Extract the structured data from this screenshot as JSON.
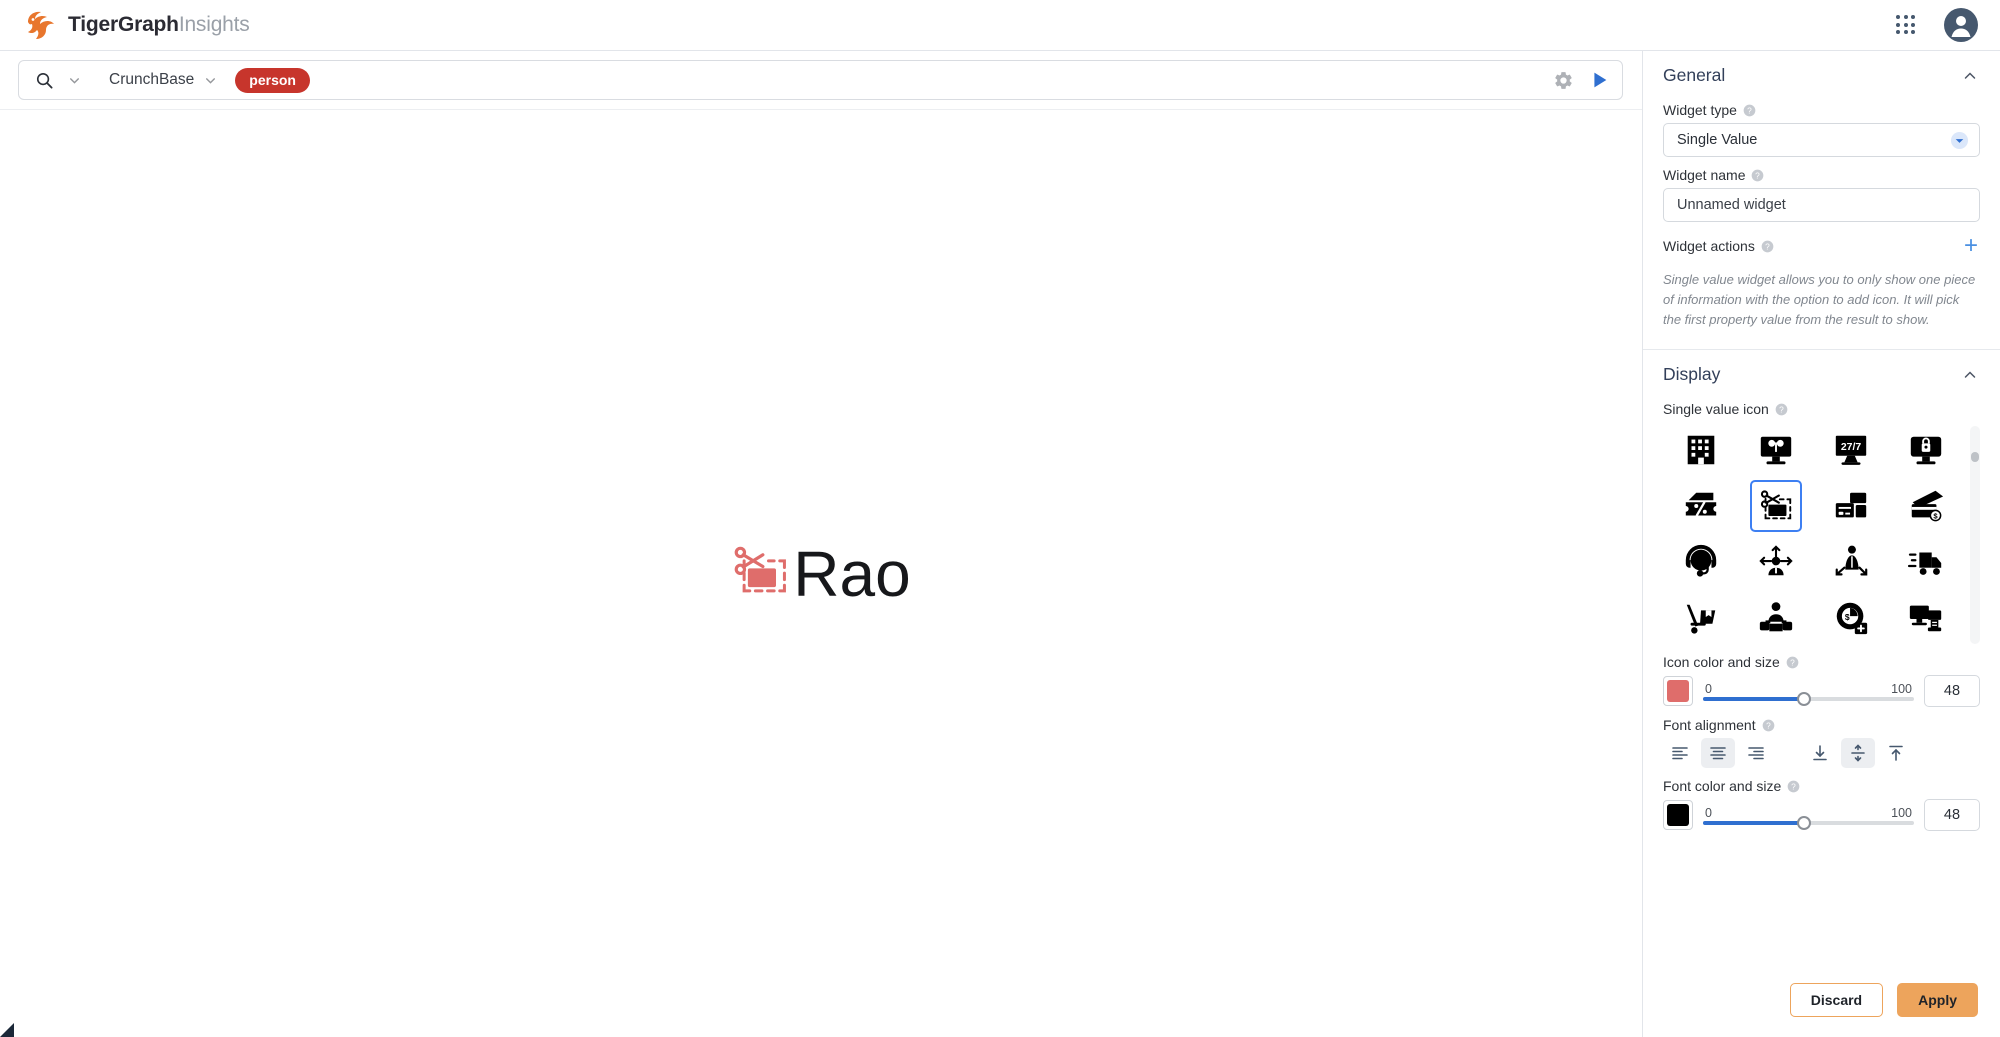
{
  "brand": {
    "name_bold": "TigerGraph",
    "name_light": "Insights",
    "logo_color": "#e8762d"
  },
  "topbar": {
    "apps_icon": "apps-grid-icon",
    "account_icon": "account-avatar-icon"
  },
  "search": {
    "search_icon": "search-icon",
    "graph_name": "CrunchBase",
    "tag": "person",
    "tag_color": "#c7352c",
    "settings_icon": "gear-icon",
    "run_icon": "play-icon"
  },
  "canvas": {
    "value_text": "Rao",
    "icon_name": "coupon-cut-icon",
    "icon_color": "#df6d6b",
    "font_color": "#17181b",
    "font_size_px": "64"
  },
  "panel": {
    "general": {
      "title": "General",
      "collapse_icon": "chevron-up-icon",
      "widget_type_label": "Widget type",
      "widget_type_value": "Single Value",
      "widget_name_label": "Widget name",
      "widget_name_value": "Unnamed widget",
      "widget_actions_label": "Widget actions",
      "add_action_label": "+",
      "hint": "Single value widget allows you to only show one piece of information with the option to add icon. It will pick the first property value from the result to show."
    },
    "display": {
      "title": "Display",
      "collapse_icon": "chevron-up-icon",
      "single_value_icon_label": "Single value icon",
      "icons": [
        {
          "name": "office-building-icon",
          "selected": false
        },
        {
          "name": "monitor-plant-icon",
          "selected": false
        },
        {
          "name": "monitor-247-icon",
          "selected": false
        },
        {
          "name": "monitor-lock-icon",
          "selected": false
        },
        {
          "name": "percent-wallet-icon",
          "selected": false
        },
        {
          "name": "coupon-cut-icon",
          "selected": true
        },
        {
          "name": "credit-cards-icon",
          "selected": false
        },
        {
          "name": "card-payment-dollar-icon",
          "selected": false
        },
        {
          "name": "headset-support-icon",
          "selected": false
        },
        {
          "name": "agent-network-icon",
          "selected": false
        },
        {
          "name": "agent-direction-icon",
          "selected": false
        },
        {
          "name": "delivery-truck-icon",
          "selected": false
        },
        {
          "name": "hand-truck-icon",
          "selected": false
        },
        {
          "name": "team-group-icon",
          "selected": false
        },
        {
          "name": "pie-chart-add-icon",
          "selected": false
        },
        {
          "name": "monitor-printer-icon",
          "selected": false
        }
      ],
      "icon_color_label": "Icon color and size",
      "icon_color_value": "#df6d6b",
      "icon_size": {
        "min": "0",
        "max": "100",
        "value": "48"
      },
      "font_alignment_label": "Font alignment",
      "horizontal_alignment": [
        {
          "name": "align-left",
          "selected": false
        },
        {
          "name": "align-center",
          "selected": true
        },
        {
          "name": "align-right",
          "selected": false
        }
      ],
      "vertical_alignment": [
        {
          "name": "align-bottom",
          "selected": false
        },
        {
          "name": "align-middle",
          "selected": true
        },
        {
          "name": "align-top",
          "selected": false
        }
      ],
      "font_color_label": "Font color and size",
      "font_color_value": "#000000",
      "font_size": {
        "min": "0",
        "max": "100",
        "value": "48"
      }
    },
    "footer": {
      "discard_label": "Discard",
      "apply_label": "Apply",
      "accent_color": "#eda45c"
    }
  }
}
